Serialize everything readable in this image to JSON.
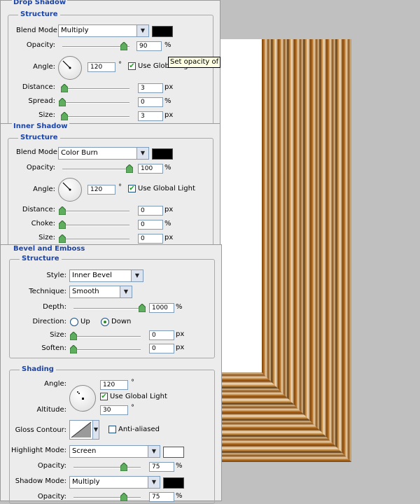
{
  "drop_shadow": {
    "title": "Drop Shadow",
    "structure": "Structure",
    "blend_mode_label": "Blend Mode:",
    "blend_mode": "Multiply",
    "color": "#000000",
    "opacity_label": "Opacity:",
    "opacity": "90",
    "opacity_unit": "%",
    "angle_label": "Angle:",
    "angle": "120",
    "angle_unit": "°",
    "use_global_light": "Use Global Light",
    "distance_label": "Distance:",
    "distance": "3",
    "distance_unit": "px",
    "spread_label": "Spread:",
    "spread": "0",
    "spread_unit": "%",
    "size_label": "Size:",
    "size": "3",
    "size_unit": "px"
  },
  "tooltip": "Set opacity of",
  "inner_shadow": {
    "title": "Inner Shadow",
    "structure": "Structure",
    "blend_mode_label": "Blend Mode:",
    "blend_mode": "Color Burn",
    "color": "#000000",
    "opacity_label": "Opacity:",
    "opacity": "100",
    "opacity_unit": "%",
    "angle_label": "Angle:",
    "angle": "120",
    "angle_unit": "°",
    "use_global_light": "Use Global Light",
    "distance_label": "Distance:",
    "distance": "0",
    "distance_unit": "px",
    "choke_label": "Choke:",
    "choke": "0",
    "choke_unit": "%",
    "size_label": "Size:",
    "size": "0",
    "size_unit": "px"
  },
  "bevel": {
    "title": "Bevel and Emboss",
    "structure": "Structure",
    "style_label": "Style:",
    "style": "Inner Bevel",
    "technique_label": "Technique:",
    "technique": "Smooth",
    "depth_label": "Depth:",
    "depth": "1000",
    "depth_unit": "%",
    "direction_label": "Direction:",
    "up": "Up",
    "down": "Down",
    "size_label": "Size:",
    "size": "0",
    "size_unit": "px",
    "soften_label": "Soften:",
    "soften": "0",
    "soften_unit": "px",
    "shading": "Shading",
    "angle_label": "Angle:",
    "angle": "120",
    "angle_unit": "°",
    "use_global_light": "Use Global Light",
    "altitude_label": "Altitude:",
    "altitude": "30",
    "altitude_unit": "°",
    "gloss_label": "Gloss Contour:",
    "anti_aliased": "Anti-aliased",
    "highlight_label": "Highlight Mode:",
    "highlight_mode": "Screen",
    "highlight_color": "#ffffff",
    "h_opacity_label": "Opacity:",
    "h_opacity": "75",
    "h_opacity_unit": "%",
    "shadow_label": "Shadow Mode:",
    "shadow_mode": "Multiply",
    "shadow_color": "#000000",
    "s_opacity_label": "Opacity:",
    "s_opacity": "75",
    "s_opacity_unit": "%"
  }
}
